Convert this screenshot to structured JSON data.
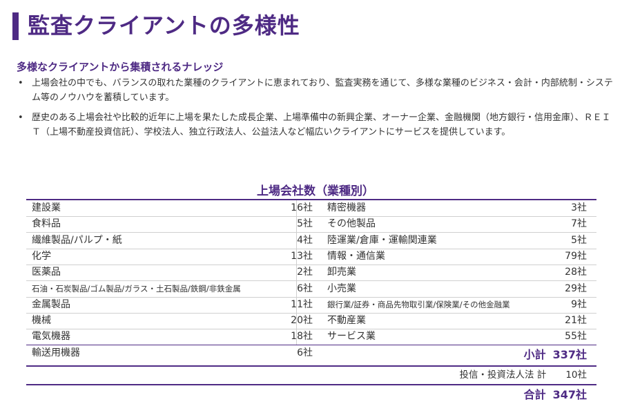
{
  "page": {
    "title": "監査クライアントの多様性",
    "subtitle": "多様なクライアントから集積されるナレッジ",
    "bullet_mark": "•",
    "bullets": [
      "上場会社の中でも、バランスの取れた業種のクライアントに恵まれており、監査実務を通じて、多様な業種のビジネス・会計・内部統制・システム等のノウハウを蓄積しています。",
      "歴史のある上場会社や比較的近年に上場を果たした成長企業、上場準備中の新興企業、オーナー企業、金融機関（地方銀行・信用金庫）、ＲＥＩＴ（上場不動産投資信託）、学校法人、独立行政法人、公益法人など幅広いクライアントにサービスを提供しています。"
    ]
  },
  "table": {
    "title": "上場会社数（業種別）",
    "rows": [
      {
        "left_name": "建設業",
        "left_count": "16社",
        "right_name": "精密機器",
        "right_count": "3社"
      },
      {
        "left_name": "食料品",
        "left_count": "5社",
        "right_name": "その他製品",
        "right_count": "7社"
      },
      {
        "left_name": "繊維製品/パルプ・紙",
        "left_count": "4社",
        "right_name": "陸運業/倉庫・運輸関連業",
        "right_count": "5社"
      },
      {
        "left_name": "化学",
        "left_count": "13社",
        "right_name": "情報・通信業",
        "right_count": "79社"
      },
      {
        "left_name": "医薬品",
        "left_count": "2社",
        "right_name": "卸売業",
        "right_count": "28社"
      },
      {
        "left_name": "石油・石炭製品/ゴム製品/ガラス・土石製品/鉄鋼/非鉄金属",
        "left_count": "6社",
        "right_name": "小売業",
        "right_count": "29社"
      },
      {
        "left_name": "金属製品",
        "left_count": "11社",
        "right_name": "銀行業/証券・商品先物取引業/保険業/その他金融業",
        "right_count": "9社"
      },
      {
        "left_name": "機械",
        "left_count": "20社",
        "right_name": "不動産業",
        "right_count": "21社"
      },
      {
        "left_name": "電気機器",
        "left_count": "18社",
        "right_name": "サービス業",
        "right_count": "55社"
      },
      {
        "left_name": "輸送用機器",
        "left_count": "6社",
        "right_name": "",
        "right_count": ""
      }
    ],
    "subtotal_label": "小計",
    "subtotal_value": "337社",
    "reit_label": "投信・投資法人法 計",
    "reit_value": "10社",
    "total_label": "合計",
    "total_value": "347社"
  },
  "colors": {
    "accent": "#4e2a84",
    "text": "#333333",
    "row_line": "#cfcfcf"
  }
}
